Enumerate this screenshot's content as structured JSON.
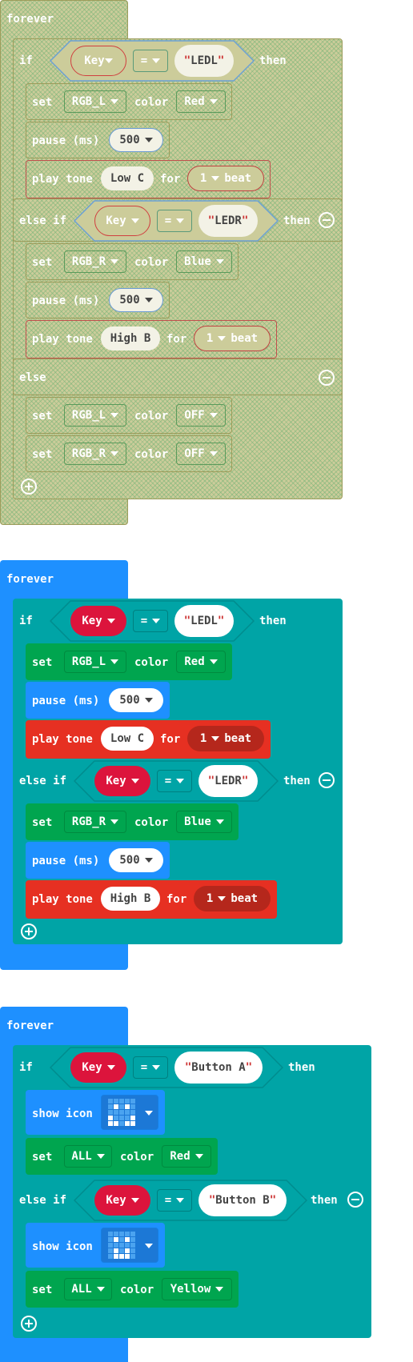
{
  "labels": {
    "forever": "forever",
    "if": "if",
    "then": "then",
    "else_if": "else if",
    "else": "else",
    "set": "set",
    "color": "color",
    "pause": "pause (ms)",
    "play_tone": "play tone",
    "for": "for",
    "beat": "beat",
    "show_icon": "show icon"
  },
  "block1": {
    "cond1": {
      "var": "Key",
      "op": "=",
      "value": "LEDL"
    },
    "set1": {
      "led": "RGB_L",
      "color": "Red"
    },
    "pause1": "500",
    "tone1": {
      "note": "Low C",
      "beats": "1"
    },
    "cond2": {
      "var": "Key",
      "op": "=",
      "value": "LEDR"
    },
    "set2": {
      "led": "RGB_R",
      "color": "Blue"
    },
    "pause2": "500",
    "tone2": {
      "note": "High B",
      "beats": "1"
    },
    "set3": {
      "led": "RGB_L",
      "color": "OFF"
    },
    "set4": {
      "led": "RGB_R",
      "color": "OFF"
    }
  },
  "block2": {
    "cond1": {
      "var": "Key",
      "op": "=",
      "value": "LEDL"
    },
    "set1": {
      "led": "RGB_L",
      "color": "Red"
    },
    "pause1": "500",
    "tone1": {
      "note": "Low C",
      "beats": "1"
    },
    "cond2": {
      "var": "Key",
      "op": "=",
      "value": "LEDR"
    },
    "set2": {
      "led": "RGB_R",
      "color": "Blue"
    },
    "pause2": "500",
    "tone2": {
      "note": "High B",
      "beats": "1"
    }
  },
  "block3": {
    "cond1": {
      "var": "Key",
      "op": "=",
      "value": "Button A"
    },
    "set1": {
      "led": "ALL",
      "color": "Red"
    },
    "cond2": {
      "var": "Key",
      "op": "=",
      "value": "Button B"
    },
    "set2": {
      "led": "ALL",
      "color": "Yellow"
    }
  },
  "colors": {
    "loop_blue": "#1e90ff",
    "logic_teal": "#00a4a6",
    "rgb_green": "#00a54f",
    "music_red": "#e63022",
    "input_pink": "#dc143c",
    "pause_blue": "#1e90ff",
    "disabled": "#cccc9a"
  },
  "icons": [
    "quote-icon",
    "dropdown-arrow-icon",
    "add-icon",
    "remove-icon",
    "led-matrix-icon"
  ]
}
